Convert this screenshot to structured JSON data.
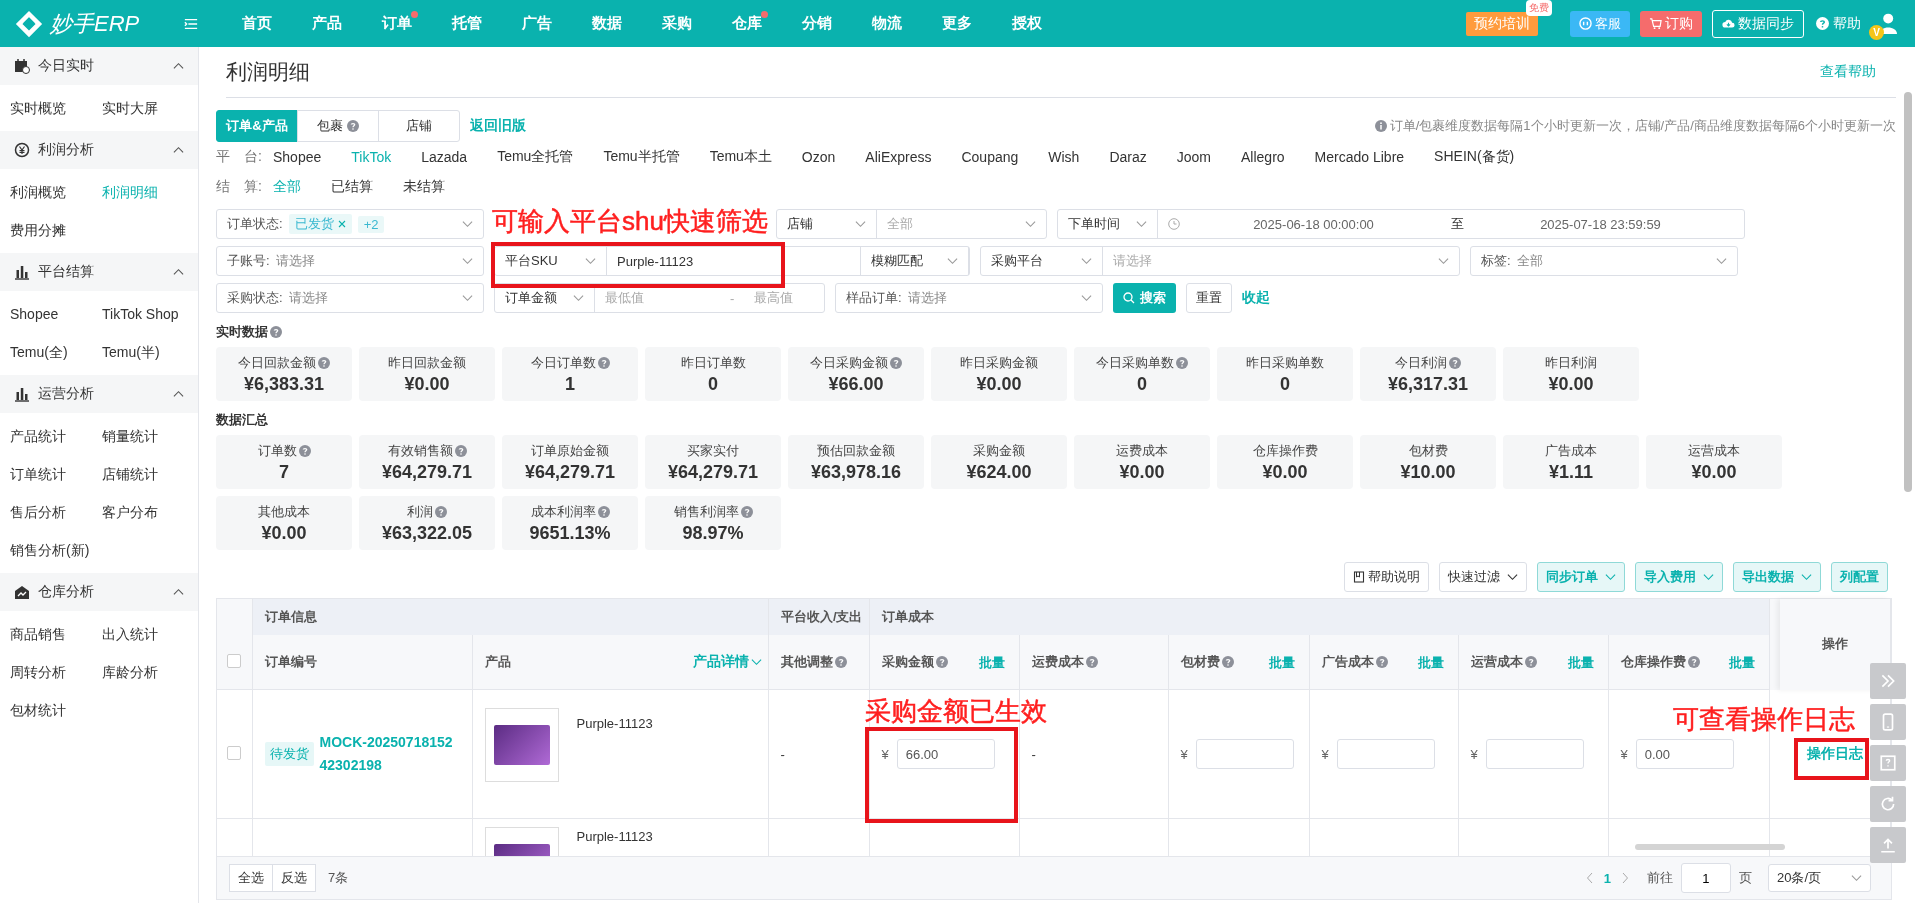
{
  "header": {
    "logo": "妙手ERP",
    "nav": [
      {
        "label": "首页",
        "dot": false
      },
      {
        "label": "产品",
        "dot": false
      },
      {
        "label": "订单",
        "dot": true
      },
      {
        "label": "托管",
        "dot": false
      },
      {
        "label": "广告",
        "dot": false
      },
      {
        "label": "数据",
        "dot": false
      },
      {
        "label": "采购",
        "dot": false
      },
      {
        "label": "仓库",
        "dot": true
      },
      {
        "label": "分销",
        "dot": false
      },
      {
        "label": "物流",
        "dot": false
      },
      {
        "label": "更多",
        "dot": false
      },
      {
        "label": "授权",
        "dot": false
      }
    ],
    "actions": {
      "training": "预约培训",
      "training_badge": "免费",
      "service": "客服",
      "order": "订购",
      "sync": "数据同步",
      "help": "帮助",
      "avatar_badge": "V"
    }
  },
  "sidebar": [
    {
      "title": "今日实时",
      "expanded": true,
      "items": [
        {
          "label": "实时概览",
          "selected": false
        },
        {
          "label": "实时大屏",
          "selected": false
        }
      ]
    },
    {
      "title": "利润分析",
      "expanded": true,
      "items": [
        {
          "label": "利润概览",
          "selected": false
        },
        {
          "label": "利润明细",
          "selected": true
        },
        {
          "label": "费用分摊",
          "selected": false
        }
      ]
    },
    {
      "title": "平台结算",
      "expanded": true,
      "items": [
        {
          "label": "Shopee",
          "selected": false
        },
        {
          "label": "TikTok Shop",
          "selected": false
        },
        {
          "label": "Temu(全)",
          "selected": false
        },
        {
          "label": "Temu(半)",
          "selected": false
        }
      ]
    },
    {
      "title": "运营分析",
      "expanded": true,
      "items": [
        {
          "label": "产品统计",
          "selected": false
        },
        {
          "label": "销量统计",
          "selected": false
        },
        {
          "label": "订单统计",
          "selected": false
        },
        {
          "label": "店铺统计",
          "selected": false
        },
        {
          "label": "售后分析",
          "selected": false
        },
        {
          "label": "客户分布",
          "selected": false
        },
        {
          "label": "销售分析(新)",
          "selected": false
        }
      ]
    },
    {
      "title": "仓库分析",
      "expanded": true,
      "items": [
        {
          "label": "商品销售",
          "selected": false
        },
        {
          "label": "出入统计",
          "selected": false
        },
        {
          "label": "周转分析",
          "selected": false
        },
        {
          "label": "库龄分析",
          "selected": false
        },
        {
          "label": "包材统计",
          "selected": false
        }
      ]
    }
  ],
  "page": {
    "title": "利润明细",
    "help_link": "查看帮助",
    "tabs": [
      {
        "label": "订单&产品",
        "help": false,
        "selected": true
      },
      {
        "label": "包裹",
        "help": true,
        "selected": false
      },
      {
        "label": "店铺",
        "help": false,
        "selected": false
      }
    ],
    "old_version_link": "返回旧版",
    "notice": "订单/包裹维度数据每隔1个小时更新一次，店铺/产品/商品维度数据每隔6个小时更新一次",
    "platform_filter": {
      "label": "平　台:",
      "options": [
        {
          "label": "Shopee",
          "selected": false
        },
        {
          "label": "TikTok",
          "selected": true
        },
        {
          "label": "Lazada",
          "selected": false
        },
        {
          "label": "Temu全托管",
          "selected": false
        },
        {
          "label": "Temu半托管",
          "selected": false
        },
        {
          "label": "Temu本土",
          "selected": false
        },
        {
          "label": "Ozon",
          "selected": false
        },
        {
          "label": "AliExpress",
          "selected": false
        },
        {
          "label": "Coupang",
          "selected": false
        },
        {
          "label": "Wish",
          "selected": false
        },
        {
          "label": "Daraz",
          "selected": false
        },
        {
          "label": "Joom",
          "selected": false
        },
        {
          "label": "Allegro",
          "selected": false
        },
        {
          "label": "Mercado Libre",
          "selected": false
        },
        {
          "label": "SHEIN(备货)",
          "selected": false
        }
      ]
    },
    "settlement_filter": {
      "label": "结　算:",
      "options": [
        {
          "label": "全部",
          "selected": true
        },
        {
          "label": "已结算",
          "selected": false
        },
        {
          "label": "未结算",
          "selected": false
        }
      ]
    }
  },
  "filters": {
    "order_status": {
      "label": "订单状态:",
      "tags": [
        {
          "label": "已发货",
          "removable": true
        },
        {
          "label": "+2",
          "removable": false
        }
      ]
    },
    "shop": {
      "select": "店铺",
      "placeholder": "全部"
    },
    "time": {
      "select": "下单时间",
      "start": "2025-06-18 00:00:00",
      "separator": "至",
      "end": "2025-07-18 23:59:59"
    },
    "sub_account": {
      "label": "子账号:",
      "placeholder": "请选择"
    },
    "sku": {
      "select": "平台SKU",
      "value": "Purple-11123",
      "match": "模糊匹配"
    },
    "purchase_platform": {
      "select": "采购平台",
      "placeholder": "请选择"
    },
    "tag": {
      "label": "标签:",
      "placeholder": "全部"
    },
    "purchase_status": {
      "label": "采购状态:",
      "placeholder": "请选择"
    },
    "amount": {
      "select": "订单金额",
      "min_placeholder": "最低值",
      "separator": "-",
      "max_placeholder": "最高值"
    },
    "sample": {
      "label": "样品订单:",
      "placeholder": "请选择"
    },
    "search_button": "搜索",
    "reset_button": "重置",
    "collapse_link": "收起"
  },
  "realtime": {
    "title": "实时数据",
    "help": true,
    "cards": [
      {
        "label": "今日回款金额",
        "help": true,
        "value": "¥6,383.31"
      },
      {
        "label": "昨日回款金额",
        "help": false,
        "value": "¥0.00"
      },
      {
        "label": "今日订单数",
        "help": true,
        "value": "1"
      },
      {
        "label": "昨日订单数",
        "help": false,
        "value": "0"
      },
      {
        "label": "今日采购金额",
        "help": true,
        "value": "¥66.00"
      },
      {
        "label": "昨日采购金额",
        "help": false,
        "value": "¥0.00"
      },
      {
        "label": "今日采购单数",
        "help": true,
        "value": "0"
      },
      {
        "label": "昨日采购单数",
        "help": false,
        "value": "0"
      },
      {
        "label": "今日利润",
        "help": true,
        "value": "¥6,317.31"
      },
      {
        "label": "昨日利润",
        "help": false,
        "value": "¥0.00"
      }
    ]
  },
  "summary": {
    "title": "数据汇总",
    "help": false,
    "cards": [
      {
        "label": "订单数",
        "help": true,
        "value": "7"
      },
      {
        "label": "有效销售额",
        "help": true,
        "value": "¥64,279.71"
      },
      {
        "label": "订单原始金额",
        "help": false,
        "value": "¥64,279.71"
      },
      {
        "label": "买家实付",
        "help": false,
        "value": "¥64,279.71"
      },
      {
        "label": "预估回款金额",
        "help": false,
        "value": "¥63,978.16"
      },
      {
        "label": "采购金额",
        "help": false,
        "value": "¥624.00"
      },
      {
        "label": "运费成本",
        "help": false,
        "value": "¥0.00"
      },
      {
        "label": "仓库操作费",
        "help": false,
        "value": "¥0.00"
      },
      {
        "label": "包材费",
        "help": false,
        "value": "¥10.00"
      },
      {
        "label": "广告成本",
        "help": false,
        "value": "¥1.11"
      },
      {
        "label": "运营成本",
        "help": false,
        "value": "¥0.00"
      },
      {
        "label": "其他成本",
        "help": false,
        "value": "¥0.00"
      },
      {
        "label": "利润",
        "help": true,
        "value": "¥63,322.05"
      },
      {
        "label": "成本利润率",
        "help": true,
        "value": "9651.13%"
      },
      {
        "label": "销售利润率",
        "help": true,
        "value": "98.97%"
      }
    ]
  },
  "toolbar": [
    {
      "label": "帮助说明",
      "kind": "plain",
      "doc_icon": true,
      "caret": false
    },
    {
      "label": "快速过滤",
      "kind": "plain",
      "doc_icon": false,
      "caret": true
    },
    {
      "label": "同步订单",
      "kind": "accent",
      "doc_icon": false,
      "caret": true
    },
    {
      "label": "导入费用",
      "kind": "accent",
      "doc_icon": false,
      "caret": true
    },
    {
      "label": "导出数据",
      "kind": "accent",
      "doc_icon": false,
      "caret": true
    },
    {
      "label": "列配置",
      "kind": "accent",
      "doc_icon": false,
      "caret": false
    }
  ],
  "table": {
    "groups": [
      "订单信息",
      "平台收入/支出",
      "订单成本"
    ],
    "action_header": "操作",
    "header_checked": false,
    "columns": [
      {
        "label": "订单编号",
        "help": false
      },
      {
        "label": "产品",
        "help": false,
        "link": "产品详情"
      },
      {
        "label": "其他调整",
        "help": true
      },
      {
        "label": "采购金额",
        "help": true,
        "batch": "批量"
      },
      {
        "label": "运费成本",
        "help": true
      },
      {
        "label": "包材费",
        "help": true,
        "batch": "批量"
      },
      {
        "label": "广告成本",
        "help": true,
        "batch": "批量"
      },
      {
        "label": "运营成本",
        "help": true,
        "batch": "批量"
      },
      {
        "label": "仓库操作费",
        "help": true,
        "batch": "批量"
      }
    ],
    "rows": [
      {
        "checked": false,
        "status": "待发货",
        "order_no": "MOCK-2025071815242302198",
        "product": "Purple-11123",
        "other_adjust": "-",
        "costs": [
          {
            "kind": "input",
            "currency": "¥",
            "value": "66.00"
          },
          {
            "kind": "text",
            "value": "-"
          },
          {
            "kind": "input",
            "currency": "¥"
          },
          {
            "kind": "input",
            "currency": "¥"
          },
          {
            "kind": "input",
            "currency": "¥"
          },
          {
            "kind": "input",
            "currency": "¥",
            "value": "0.00"
          }
        ],
        "action": "操作日志"
      },
      {
        "product": "Purple-11123"
      }
    ]
  },
  "footer": {
    "select_all": "全选",
    "invert": "反选",
    "count": "7条",
    "pages": [
      {
        "label": "1",
        "selected": true
      }
    ],
    "goto": "前往",
    "goto_value": "1",
    "page_unit": "页",
    "page_size": "20条/页"
  },
  "annotations": [
    "可输入平台shu快速筛选",
    "采购金额已生效",
    "可查看操作日志"
  ]
}
